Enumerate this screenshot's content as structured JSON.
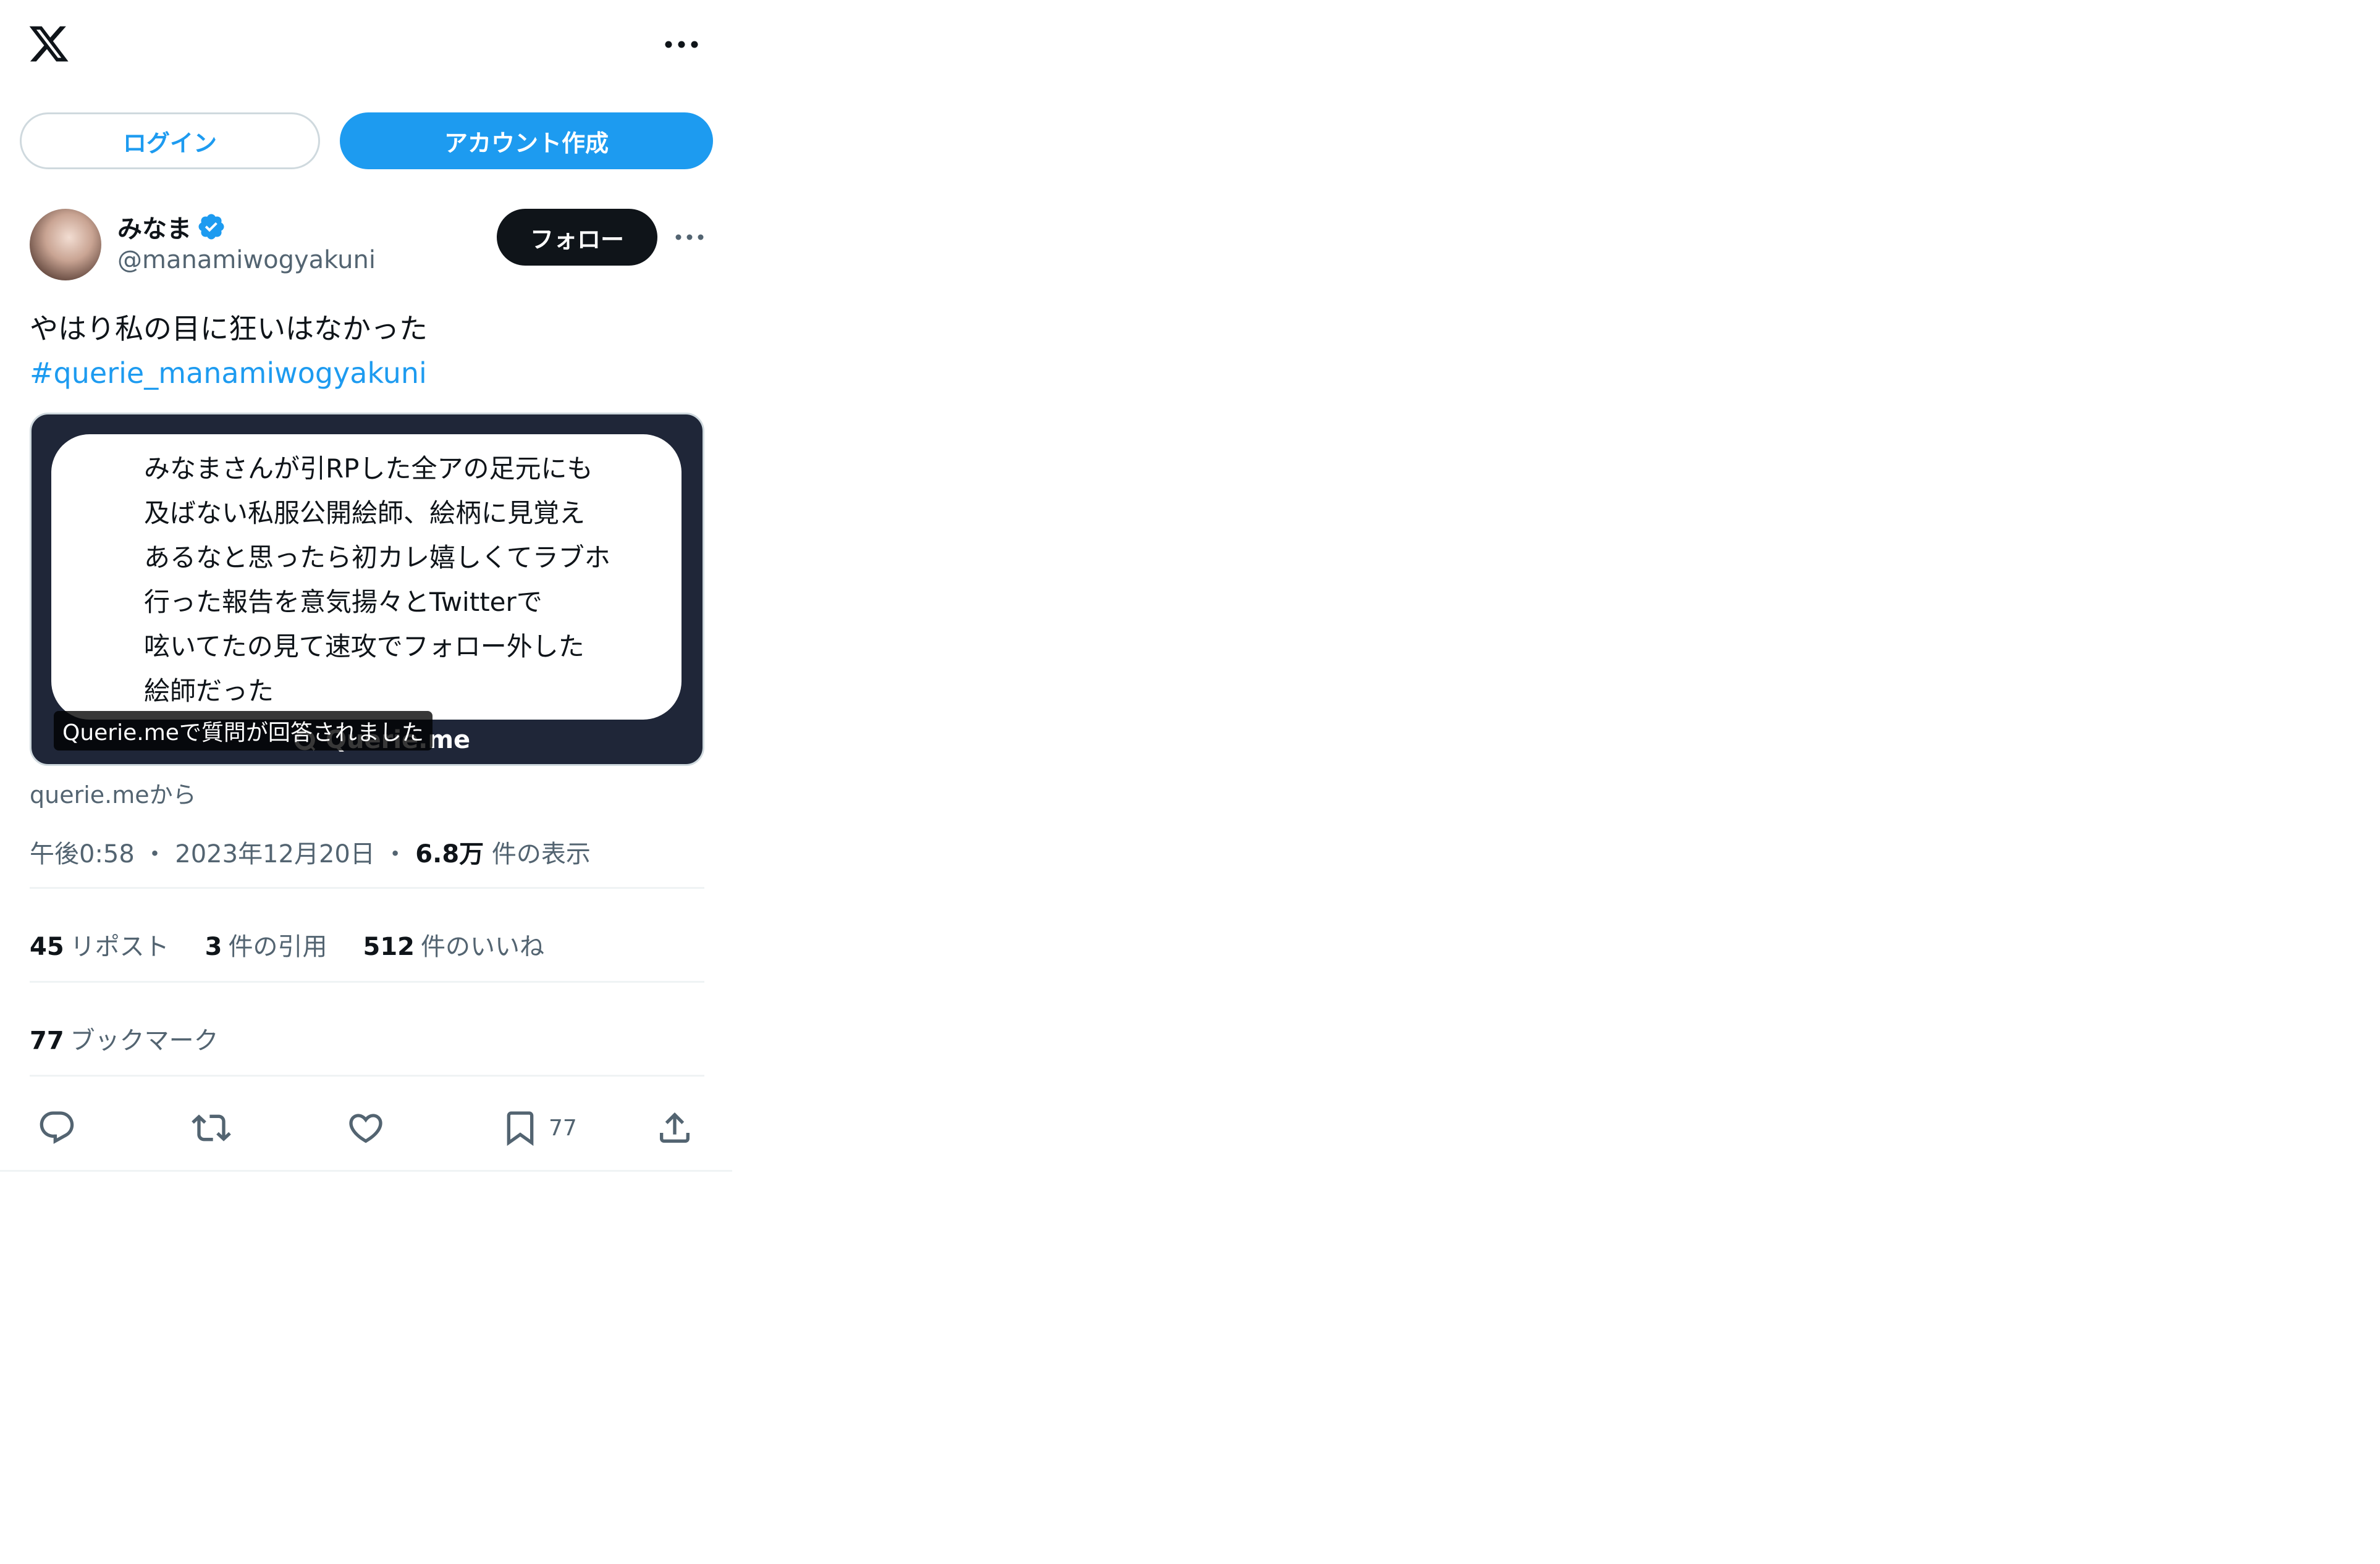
{
  "header": {
    "logo_icon": "x-logo-icon",
    "more_icon": "more-horizontal-icon"
  },
  "auth": {
    "login_label": "ログイン",
    "signup_label": "アカウント作成"
  },
  "author": {
    "display_name": "みなま",
    "handle": "@manamiwogyakuni",
    "verified": true,
    "follow_label": "フォロー"
  },
  "post": {
    "text": "やはり私の目に狂いはなかった",
    "hashtag": "#querie_manamiwogyakuni",
    "card": {
      "question_text": "みなまさんが引RPした全アの足元にも\n及ばない私服公開絵師、絵柄に見覚え\nあるなと思ったら初カレ嬉しくてラブホ\n行った報告を意気揚々とTwitterで\n呟いてたの見て速攻でフォロー外した\n絵師だった",
      "brand": "Querie.me",
      "caption": "Querie.meで質問が回答されました"
    },
    "source": "querie.meから",
    "time": "午後0:58",
    "date": "2023年12月20日",
    "views_value": "6.8万",
    "views_label": "件の表示"
  },
  "stats": {
    "reposts_value": "45",
    "reposts_label": "リポスト",
    "quotes_value": "3",
    "quotes_label": "件の引用",
    "likes_value": "512",
    "likes_label": "件のいいね",
    "bookmarks_value": "77",
    "bookmarks_label": "ブックマーク"
  },
  "actions": {
    "bookmark_count": "77"
  },
  "colors": {
    "accent": "#1d9bf0",
    "text": "#0f1419",
    "muted": "#536471",
    "card_bg": "#1f2638"
  }
}
